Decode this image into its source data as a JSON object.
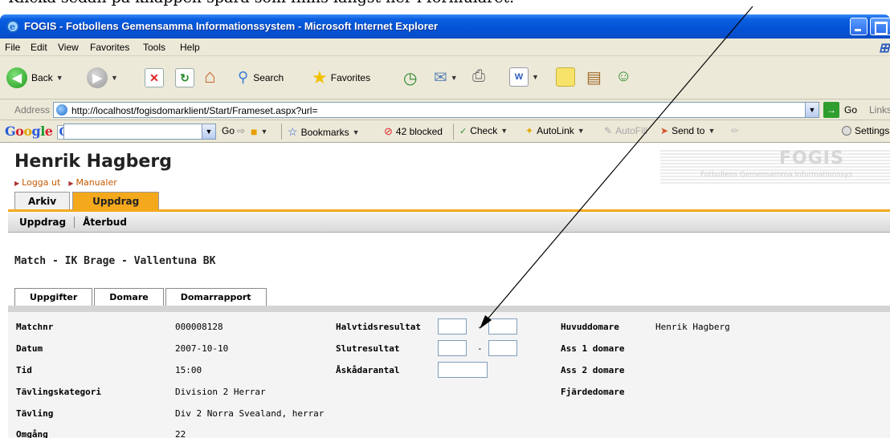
{
  "doc_caption": "Klicka sedan på knappen spara som finns längst ner i formuläret.",
  "window": {
    "title": "FOGIS - Fotbollens Gemensamma Informationssystem - Microsoft Internet Explorer"
  },
  "menu": [
    "File",
    "Edit",
    "View",
    "Favorites",
    "Tools",
    "Help"
  ],
  "toolbar": {
    "back_label": "Back",
    "search_label": "Search",
    "favorites_label": "Favorites"
  },
  "address": {
    "label": "Address",
    "url": "http://localhost/fogisdomarklient/Start/Frameset.aspx?url=",
    "go_label": "Go",
    "links_label": "Links"
  },
  "google": {
    "go_label": "Go",
    "bookmarks_label": "Bookmarks",
    "blocked_label": "42 blocked",
    "check_label": "Check",
    "autolink_label": "AutoLink",
    "autofill_label": "AutoFill",
    "sendto_label": "Send to",
    "settings_label": "Settings"
  },
  "page": {
    "user_name": "Henrik Hagberg",
    "logout_label": "Logga ut",
    "manualer_label": "Manualer",
    "logo_text": "FOGIS",
    "logo_sub": "Fotbollens Gemensamma Informationssys",
    "main_tabs": [
      "Arkiv",
      "Uppdrag"
    ],
    "subnav": [
      "Uppdrag",
      "Återbud"
    ],
    "match_title": "Match - IK Brage - Vallentuna BK",
    "detail_tabs": [
      "Uppgifter",
      "Domare",
      "Domarrapport"
    ],
    "fields": {
      "matchnr_label": "Matchnr",
      "matchnr": "000008128",
      "datum_label": "Datum",
      "datum": "2007-10-10",
      "tid_label": "Tid",
      "tid": "15:00",
      "kategori_label": "Tävlingskategori",
      "kategori": "Division 2 Herrar",
      "tavling_label": "Tävling",
      "tavling": "Div 2 Norra Svealand, herrar",
      "omgang_label": "Omgång",
      "omgang": "22",
      "halvtid_label": "Halvtidsresultat",
      "slut_label": "Slutresultat",
      "askadare_label": "Åskådarantal",
      "huvuddomare_label": "Huvuddomare",
      "huvuddomare": "Henrik Hagberg",
      "ass1_label": "Ass 1 domare",
      "ass2_label": "Ass 2 domare",
      "fjarde_label": "Fjärdedomare"
    }
  }
}
